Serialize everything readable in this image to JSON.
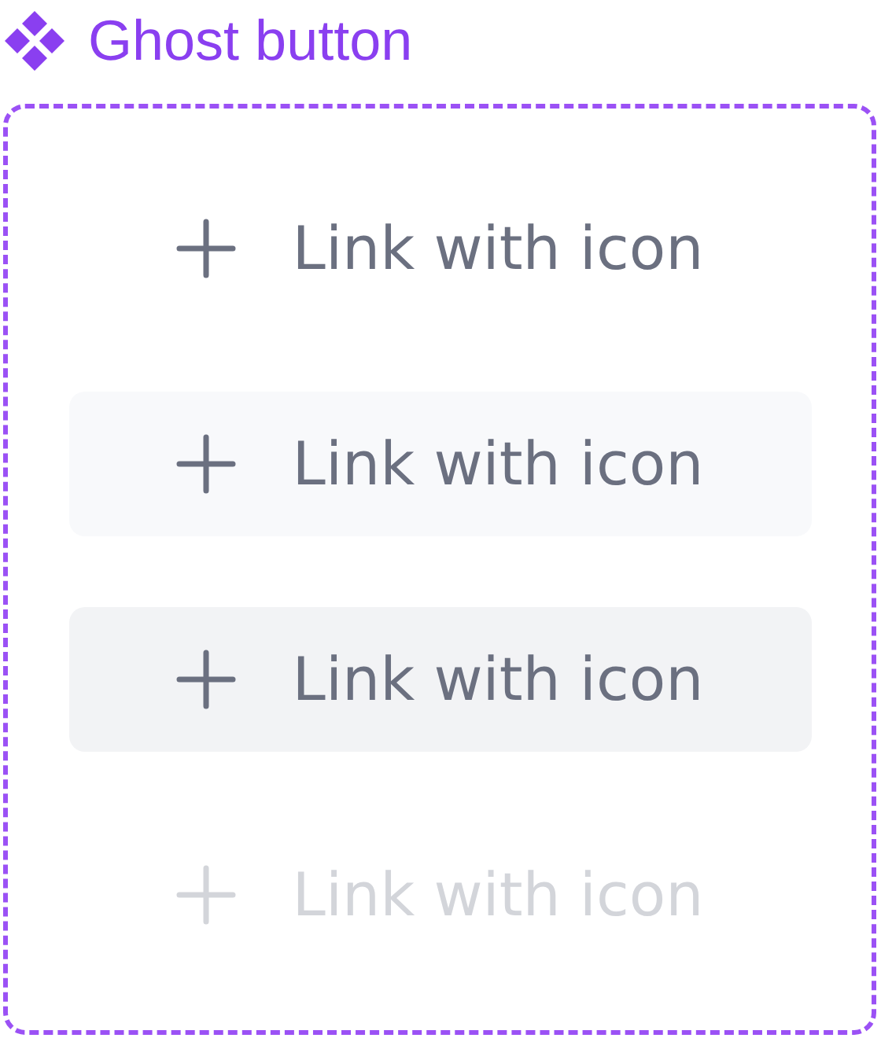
{
  "title": "Ghost button",
  "buttons": [
    {
      "label": "Link with icon",
      "kind": "default"
    },
    {
      "label": "Link with icon",
      "kind": "hover"
    },
    {
      "label": "Link with icon",
      "kind": "pressed"
    },
    {
      "label": "Link with icon",
      "kind": "disabled"
    }
  ]
}
